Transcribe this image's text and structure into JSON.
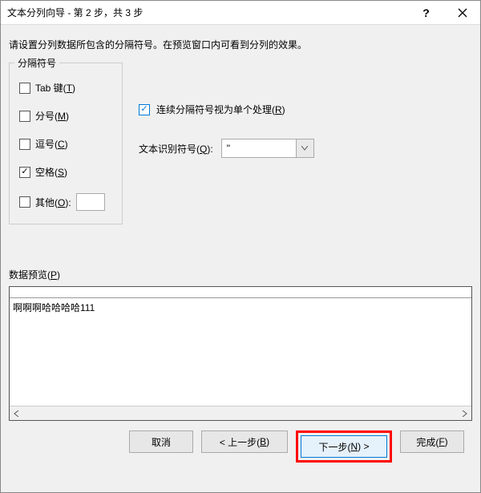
{
  "titlebar": {
    "title": "文本分列向导 - 第 2 步，共 3 步",
    "help_label": "?",
    "close_label": "✕"
  },
  "instruction": "请设置分列数据所包含的分隔符号。在预览窗口内可看到分列的效果。",
  "delimiters": {
    "legend": "分隔符号",
    "tab": {
      "label_pre": "Tab 键(",
      "hotkey": "T",
      "label_post": ")",
      "checked": false
    },
    "semicolon": {
      "label_pre": "分号(",
      "hotkey": "M",
      "label_post": ")",
      "checked": false
    },
    "comma": {
      "label_pre": "逗号(",
      "hotkey": "C",
      "label_post": ")",
      "checked": false
    },
    "space": {
      "label_pre": "空格(",
      "hotkey": "S",
      "label_post": ")",
      "checked": true
    },
    "other": {
      "label_pre": "其他(",
      "hotkey": "O",
      "label_post": "):",
      "checked": false,
      "value": ""
    }
  },
  "consecutive": {
    "label_pre": "连续分隔符号视为单个处理(",
    "hotkey": "R",
    "label_post": ")",
    "checked": true
  },
  "text_qualifier": {
    "label_pre": "文本识别符号(",
    "hotkey": "Q",
    "label_post": "):",
    "value": "\""
  },
  "preview": {
    "label_pre": "数据预览(",
    "hotkey": "P",
    "label_post": ")",
    "content": "啊啊啊哈哈哈哈111"
  },
  "buttons": {
    "cancel": "取消",
    "back_pre": "< 上一步(",
    "back_hotkey": "B",
    "back_post": ")",
    "next_pre": "下一步(",
    "next_hotkey": "N",
    "next_post": ") >",
    "finish_pre": "完成(",
    "finish_hotkey": "F",
    "finish_post": ")"
  }
}
